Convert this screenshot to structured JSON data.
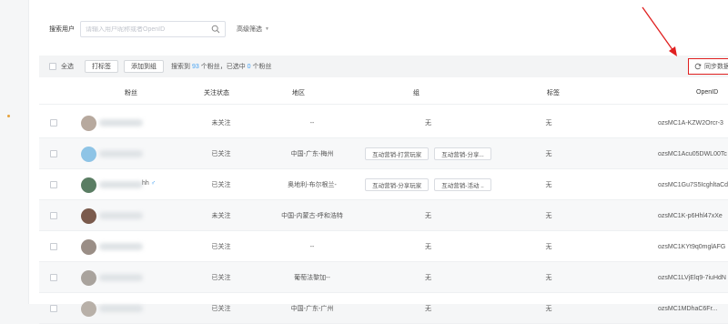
{
  "search": {
    "label": "搜索用户",
    "placeholder": "请输入用户昵称或者OpenID",
    "advanced_filter": "高级筛选"
  },
  "toolbar": {
    "select_all": "全选",
    "tag_button": "打标签",
    "add_group_button": "添加到组",
    "summary_prefix": "搜索到",
    "found_count": "93",
    "summary_mid": "个粉丝，已选中",
    "selected_count": "0",
    "summary_suffix": "个粉丝",
    "sync_button": "同步数据"
  },
  "table": {
    "headers": {
      "fan": "粉丝",
      "follow_status": "关注状态",
      "region": "地区",
      "group": "组",
      "tag": "标签",
      "openid": "OpenID"
    },
    "rows": [
      {
        "avatar_color": "#b7a99e",
        "name_suffix": "",
        "status": "未关注",
        "region": "--",
        "groups": [],
        "group_text": "无",
        "tag": "无",
        "openid": "ozsMC1A-KZW2Orcr-3"
      },
      {
        "avatar_color": "#8ec4e6",
        "name_suffix": "",
        "status": "已关注",
        "region": "中国-广东-梅州",
        "groups": [
          "互动营销-打赏玩家",
          "互动营销-分享..."
        ],
        "group_text": "",
        "tag": "无",
        "openid": "ozsMC1Acu05DWL00Tc"
      },
      {
        "avatar_color": "#5a7d63",
        "name_suffix": "hh",
        "status": "已关注",
        "region": "奥地利-布尔根兰-",
        "groups": [
          "互动营销-分享玩家",
          "互动营销-活动 .."
        ],
        "group_text": "",
        "tag": "无",
        "openid": "ozsMC1Gu7S5IcghltaCd"
      },
      {
        "avatar_color": "#7a5a4c",
        "name_suffix": "",
        "status": "未关注",
        "region": "中国-内蒙古-呼和浩特",
        "groups": [],
        "group_text": "无",
        "tag": "无",
        "openid": "ozsMC1K-p6Hhl47xXe"
      },
      {
        "avatar_color": "#9a8e86",
        "name_suffix": "",
        "status": "已关注",
        "region": "--",
        "groups": [],
        "group_text": "无",
        "tag": "无",
        "openid": "ozsMC1KYt9q0mglAFG"
      },
      {
        "avatar_color": "#a9a39d",
        "name_suffix": "",
        "status": "已关注",
        "region": "葡萄法黎加--",
        "groups": [],
        "group_text": "无",
        "tag": "无",
        "openid": "ozsMC1LVjElq9-7iuHdN"
      },
      {
        "avatar_color": "#b8b0a8",
        "name_suffix": "",
        "status": "已关注",
        "region": "中国-广东-广州",
        "groups": [],
        "group_text": "无",
        "tag": "无",
        "openid": "ozsMC1MDhaC6Fr..."
      }
    ]
  },
  "colors": {
    "accent": "#44a1f2",
    "highlight_border": "#e02020"
  }
}
